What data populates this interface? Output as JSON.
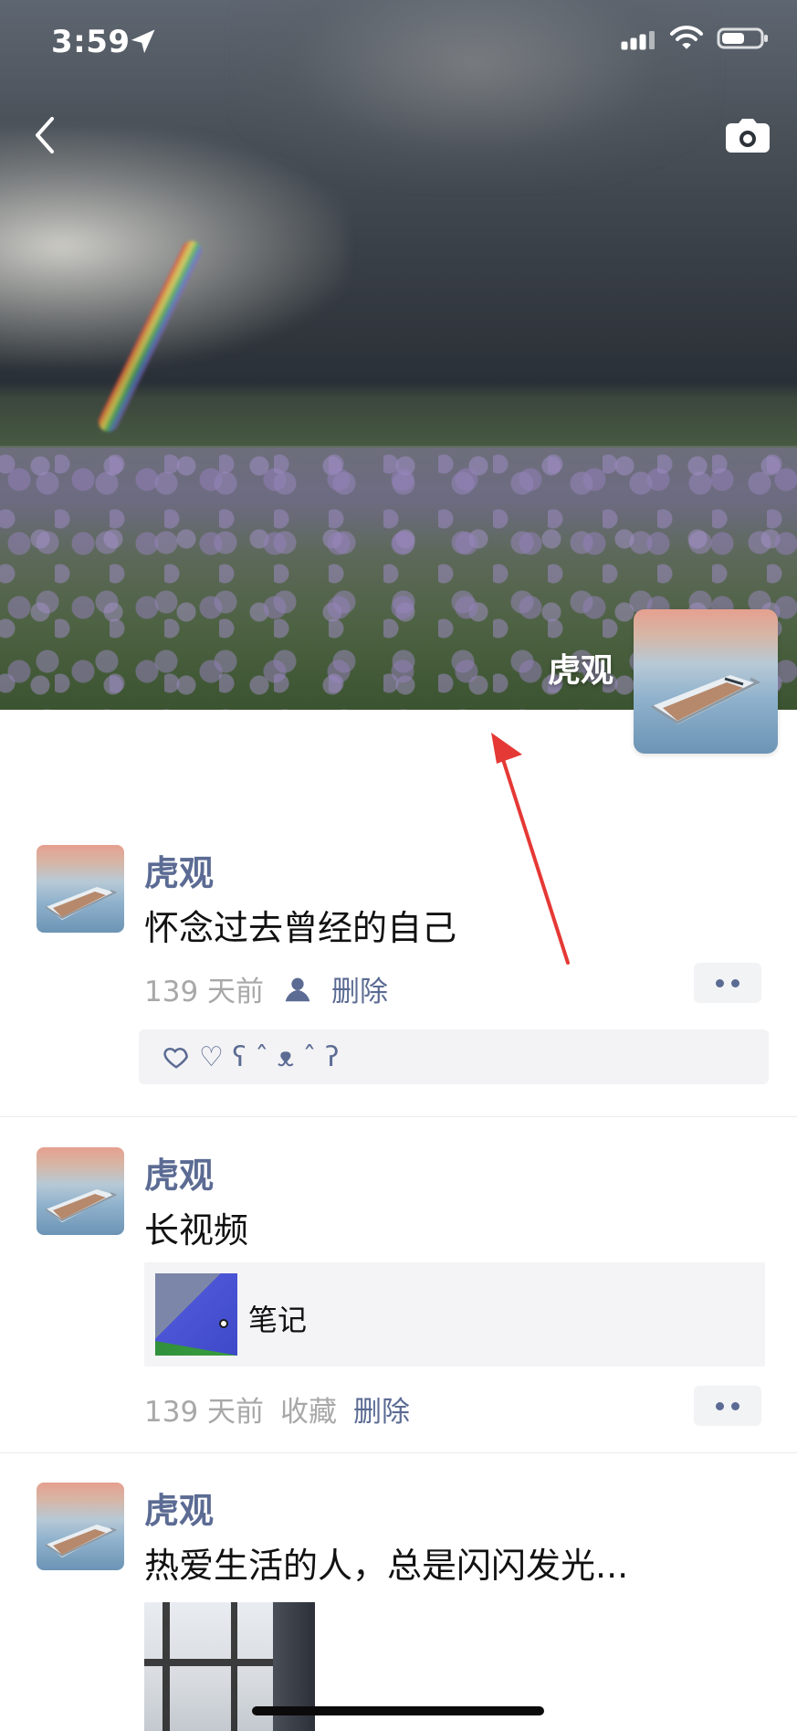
{
  "status_bar": {
    "time": "3:59"
  },
  "header": {
    "profile_name": "虎观"
  },
  "icons": {
    "back": "chevron-left-icon",
    "camera": "camera-icon",
    "location": "location-arrow-icon",
    "signal": "signal-icon",
    "wifi": "wifi-icon",
    "battery": "battery-icon",
    "person": "person-icon",
    "heart": "heart-icon",
    "more": "more-dots-icon"
  },
  "posts": [
    {
      "username": "虎观",
      "text": "怀念过去曾经的自己",
      "time": "139 天前",
      "action": "删除",
      "likes": "♡ ʕ ˆ ᴥ ˆ ʔ"
    },
    {
      "username": "虎观",
      "text": "长视频",
      "link_title": "笔记",
      "time": "139 天前",
      "collect": "收藏",
      "action": "删除"
    },
    {
      "username": "虎观",
      "text": "热爱生活的人，总是闪闪发光..."
    }
  ],
  "colors": {
    "link": "#5b6b93",
    "annotation_arrow": "#e53935"
  }
}
